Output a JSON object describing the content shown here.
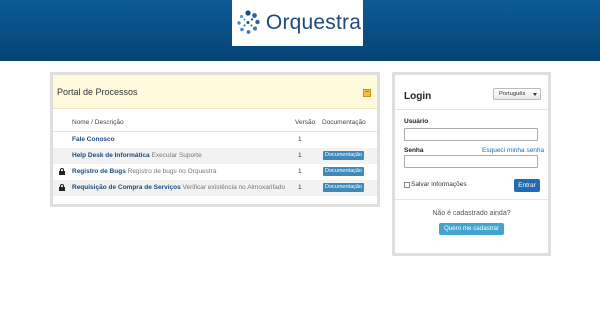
{
  "header": {
    "logo_text": "Orquestra",
    "logo_icon": "orquestra-dots-logo",
    "bg_color": "#0a4f85"
  },
  "processes": {
    "title": "Portal de Processos",
    "collapse_icon": "minus-square-icon",
    "columns": {
      "name": "Nome / Descrição",
      "version": "Versão",
      "docs": "Documentação"
    },
    "rows": [
      {
        "locked": false,
        "name": "Fale Conosco",
        "description": "",
        "version": "1",
        "doc_label": ""
      },
      {
        "locked": false,
        "name": "Help Desk de Informática",
        "description": "Executar Suporte",
        "version": "1",
        "doc_label": "Documentação"
      },
      {
        "locked": true,
        "name": "Registro de Bugs",
        "description": "Registro de bugs no Orquestra",
        "version": "1",
        "doc_label": "Documentação"
      },
      {
        "locked": true,
        "name": "Requisição de Compra de Serviços",
        "description": "Verificar existência no Almoxarifado",
        "version": "1",
        "doc_label": "Documentação"
      }
    ]
  },
  "login": {
    "title": "Login",
    "language": "Português",
    "user_label": "Usuário",
    "user_value": "",
    "password_label": "Senha",
    "password_value": "",
    "forgot_link": "Esqueci minha senha",
    "remember_label": "Salvar informações",
    "enter_button": "Entrar",
    "not_registered": "Não é cadastrado ainda?",
    "register_button": "Quero me cadastrar"
  }
}
